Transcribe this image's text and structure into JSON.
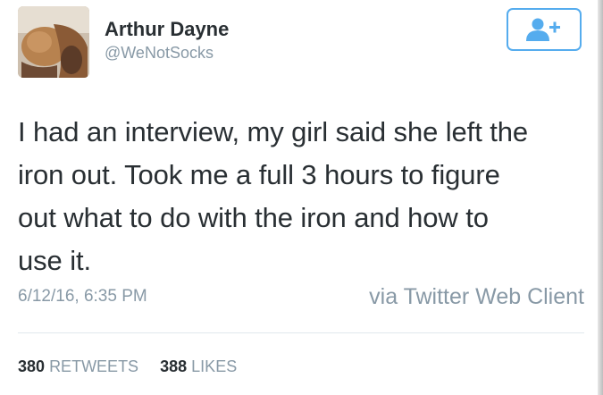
{
  "user": {
    "display_name": "Arthur Dayne",
    "handle": "@WeNotSocks",
    "avatar_icon": "profile-photo"
  },
  "follow_button": {
    "icon": "add-user-icon",
    "color": "#55acee"
  },
  "tweet": {
    "lines": [
      "I had an interview, my girl said she left the",
      "iron out. Took me a full 3 hours to figure",
      "out what to do with the iron and how to",
      "use it."
    ],
    "timestamp": "6/12/16, 6:35 PM",
    "source": "via Twitter Web Client"
  },
  "stats": {
    "retweets_count": "380",
    "retweets_label": "RETWEETS",
    "likes_count": "388",
    "likes_label": "LIKES"
  },
  "colors": {
    "text": "#292f33",
    "muted": "#8899a6",
    "accent": "#55acee",
    "divider": "#e1e8ed"
  }
}
